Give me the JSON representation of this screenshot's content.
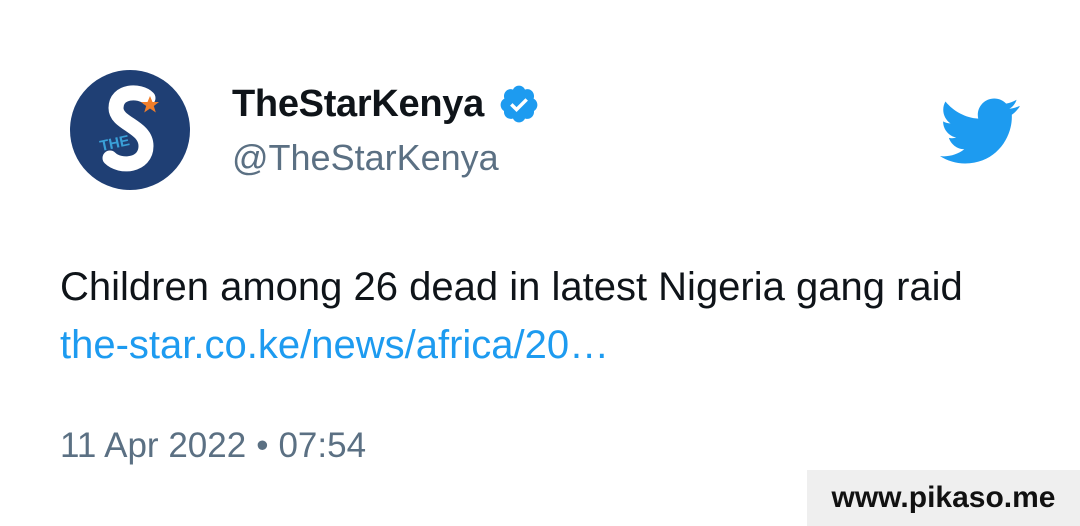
{
  "author": {
    "display_name": "TheStarKenya",
    "handle": "@TheStarKenya",
    "verified": true,
    "avatar_logo_text": "THE S",
    "avatar_colors": {
      "background": "#1f3f74",
      "letter": "#ffffff",
      "accent_text": "#3aa0d8",
      "star": "#f07e2a"
    }
  },
  "tweet": {
    "text": "Children among 26 dead in latest Nigeria gang raid",
    "link": "the-star.co.ke/news/africa/20…",
    "date": "11 Apr 2022",
    "separator": "•",
    "time": "07:54"
  },
  "icons": {
    "verified": "verified-badge-icon",
    "brand": "twitter-bird-icon"
  },
  "colors": {
    "text": "#0f1419",
    "muted": "#5b7083",
    "link": "#1d9bf0",
    "twitter_blue": "#1d9bf0",
    "watermark_bg": "#efefef"
  },
  "watermark": {
    "text": "www.pikaso.me"
  }
}
